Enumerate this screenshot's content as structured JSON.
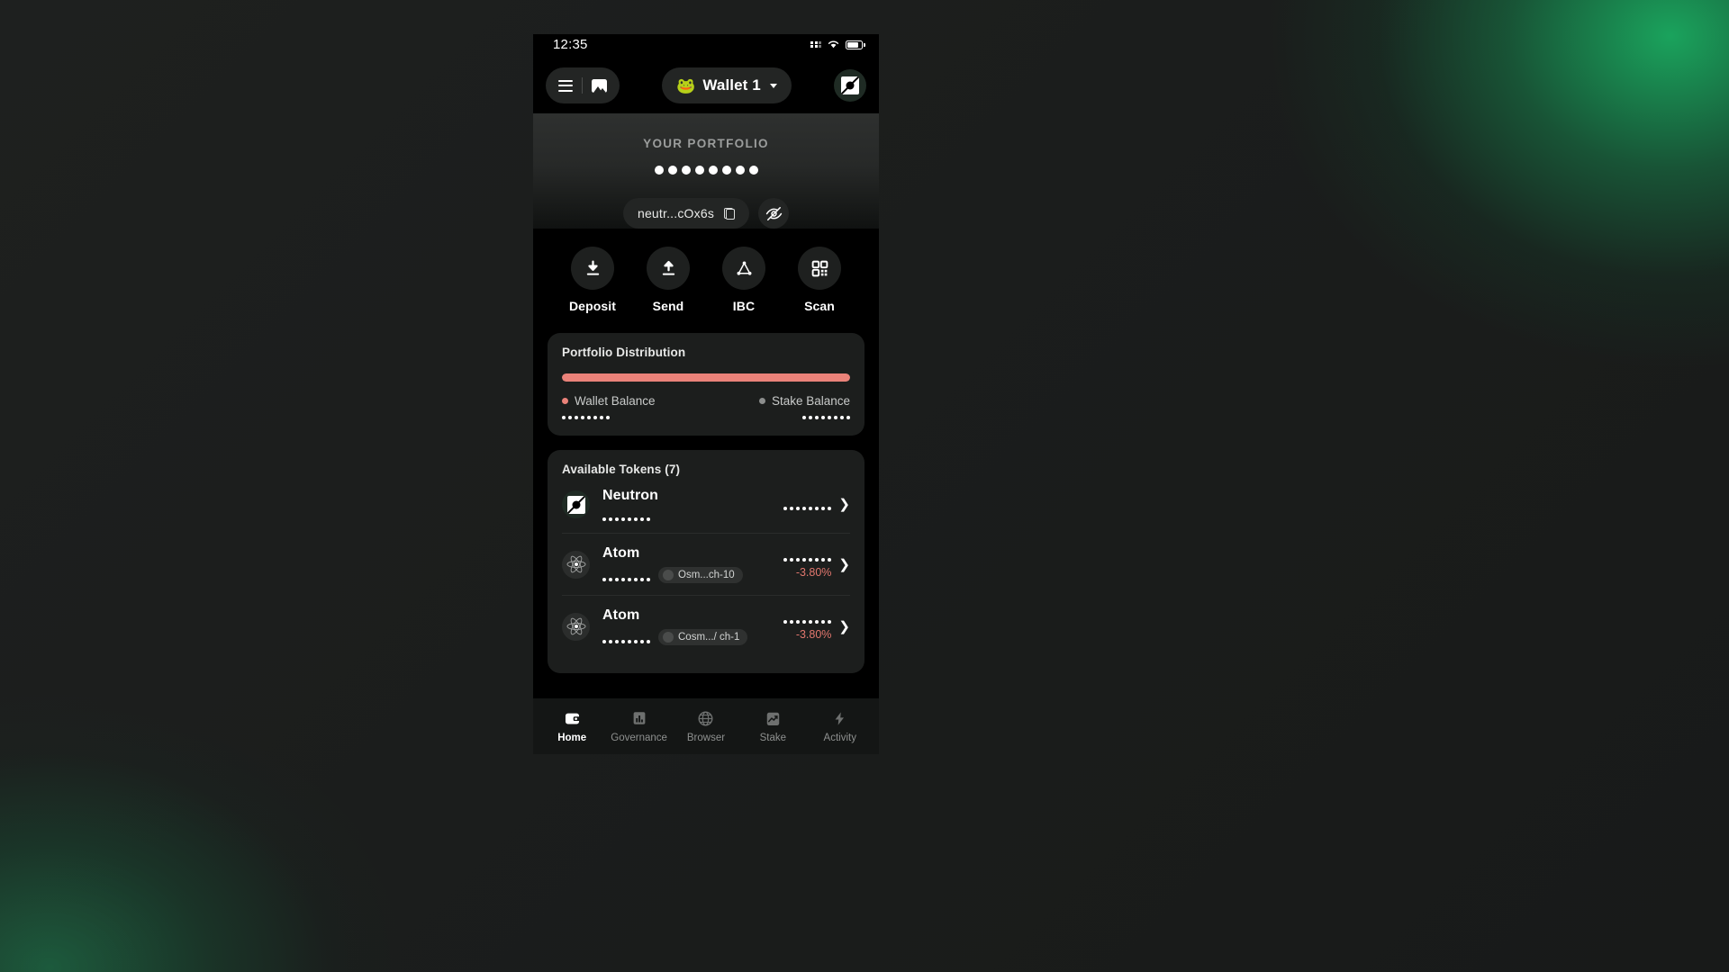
{
  "status_bar": {
    "time": "12:35",
    "icons": [
      "signal-icon",
      "wifi-icon",
      "battery-icon"
    ]
  },
  "header": {
    "menu_icon": "hamburger-menu-icon",
    "gallery_icon": "image-icon",
    "wallet_avatar": "🐸",
    "wallet_name": "Wallet 1",
    "dropdown_icon": "chevron-down-icon",
    "network_logo": "neutron-logo-icon"
  },
  "portfolio": {
    "title": "YOUR PORTFOLIO",
    "balance_hidden": true,
    "balance_dot_count": 8,
    "address": "neutr...cOx6s",
    "copy_icon": "copy-icon",
    "hide_icon": "eye-off-icon"
  },
  "actions": [
    {
      "label": "Deposit",
      "icon": "download-arrow-icon"
    },
    {
      "label": "Send",
      "icon": "upload-arrow-icon"
    },
    {
      "label": "IBC",
      "icon": "network-nodes-icon"
    },
    {
      "label": "Scan",
      "icon": "qr-code-icon"
    }
  ],
  "distribution": {
    "title": "Portfolio Distribution",
    "colors": {
      "wallet": "#ea8279",
      "stake": "#8c8e8d",
      "track": "#3a3c3b"
    },
    "segments": [
      {
        "name": "Wallet Balance",
        "percent": 100,
        "color": "#ea8279",
        "value_hidden": true,
        "dot_count": 8
      },
      {
        "name": "Stake Balance",
        "percent": 0,
        "color": "#8c8e8d",
        "value_hidden": true,
        "dot_count": 8
      }
    ]
  },
  "tokens": {
    "title": "Available Tokens (7)",
    "count": 7,
    "rows": [
      {
        "name": "Neutron",
        "icon": "neutron-logo-icon",
        "amount_hidden": true,
        "amount_dot_count": 8,
        "value_hidden": true,
        "value_dot_count": 8,
        "badge": null,
        "change": null,
        "chevron": "chevron-right-icon"
      },
      {
        "name": "Atom",
        "icon": "atom-logo-icon",
        "amount_hidden": true,
        "amount_dot_count": 8,
        "value_hidden": true,
        "value_dot_count": 8,
        "badge": "Osm...ch-10",
        "change": "-3.80%",
        "change_color": "#e2776e",
        "chevron": "chevron-right-icon"
      },
      {
        "name": "Atom",
        "icon": "atom-logo-icon",
        "amount_hidden": true,
        "amount_dot_count": 8,
        "value_hidden": true,
        "value_dot_count": 8,
        "badge": "Cosm.../ ch-1",
        "change": "-3.80%",
        "change_color": "#e2776e",
        "chevron": "chevron-right-icon"
      }
    ]
  },
  "tabbar": {
    "active": "Home",
    "items": [
      {
        "label": "Home",
        "icon": "wallet-icon",
        "active": true
      },
      {
        "label": "Governance",
        "icon": "bar-chart-icon",
        "active": false
      },
      {
        "label": "Browser",
        "icon": "globe-icon",
        "active": false
      },
      {
        "label": "Stake",
        "icon": "chart-growth-icon",
        "active": false
      },
      {
        "label": "Activity",
        "icon": "lightning-bolt-icon",
        "active": false
      }
    ]
  },
  "theme": {
    "background_glow": "#1aaa60",
    "page_background": "#1b1d1c",
    "phone_background": "#000000",
    "card_background": "#1c1e1d",
    "accent_red": "#ea8279"
  }
}
